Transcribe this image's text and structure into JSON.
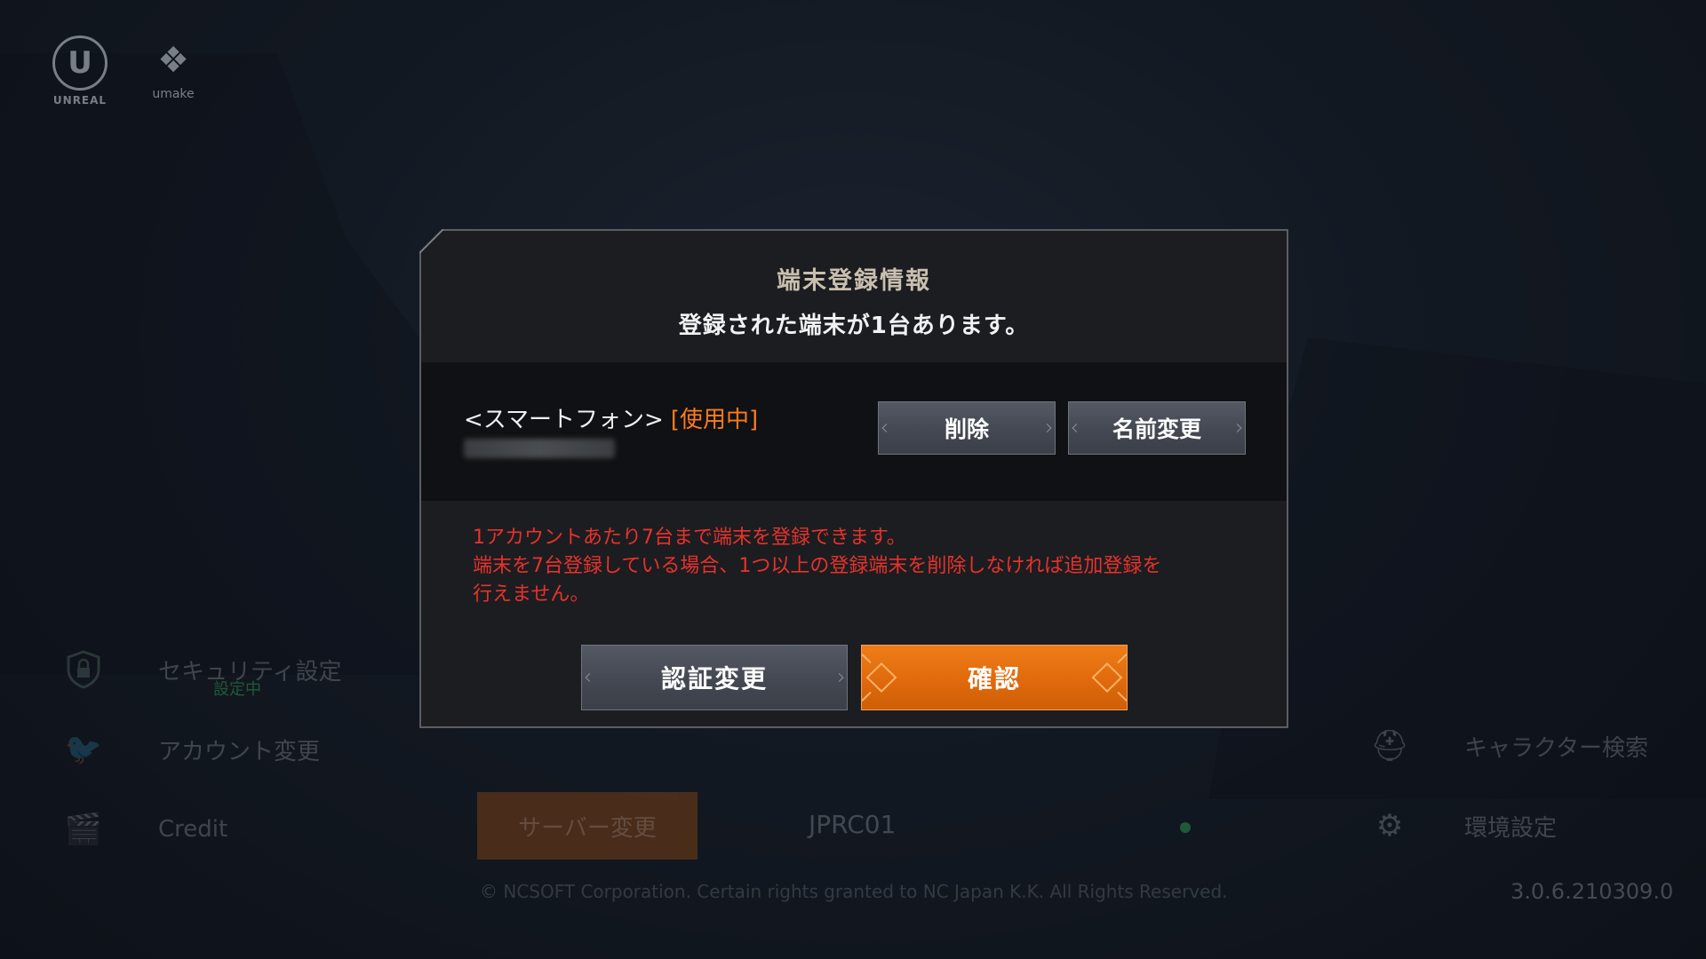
{
  "logos": {
    "unreal": {
      "mark": "U",
      "text": "UNREAL"
    },
    "second": {
      "mark": "❖",
      "text": "umake"
    }
  },
  "side_menu": [
    {
      "label": "セキュリティ設定",
      "sub": "設定中",
      "icon": "shield-lock-icon"
    },
    {
      "label": "アカウント変更",
      "icon": "twitter-bird-icon"
    },
    {
      "label": "Credit",
      "icon": "clapperboard-icon"
    }
  ],
  "server": {
    "button_label": "サーバー変更",
    "name": "JPRC01",
    "status_color": "#3dd36a"
  },
  "right_menu": [
    {
      "label": "キャラクター検索",
      "icon": "helmet-icon"
    },
    {
      "label": "環境設定",
      "icon": "gear-icon"
    }
  ],
  "footer": {
    "copyright": "© NCSOFT Corporation. Certain rights granted to NC Japan K.K. All Rights Reserved.",
    "version": "3.0.6.210309.0"
  },
  "dialog": {
    "title": "端末登録情報",
    "subtitle": "登録された端末が1台あります。",
    "device": {
      "name": "<スマートフォン>",
      "status": "[使用中]"
    },
    "buttons": {
      "delete": "削除",
      "rename": "名前変更",
      "change_auth": "認証変更",
      "confirm": "確認"
    },
    "notice": [
      "1アカウントあたり7台まで端末を登録できます。",
      "端末を7台登録している場合、1つ以上の登録端末を削除しなければ追加登録を",
      "行えません。"
    ],
    "colors": {
      "notice": "#e8322a",
      "status": "#ff7a1a",
      "confirm": "#e06a0c"
    }
  }
}
